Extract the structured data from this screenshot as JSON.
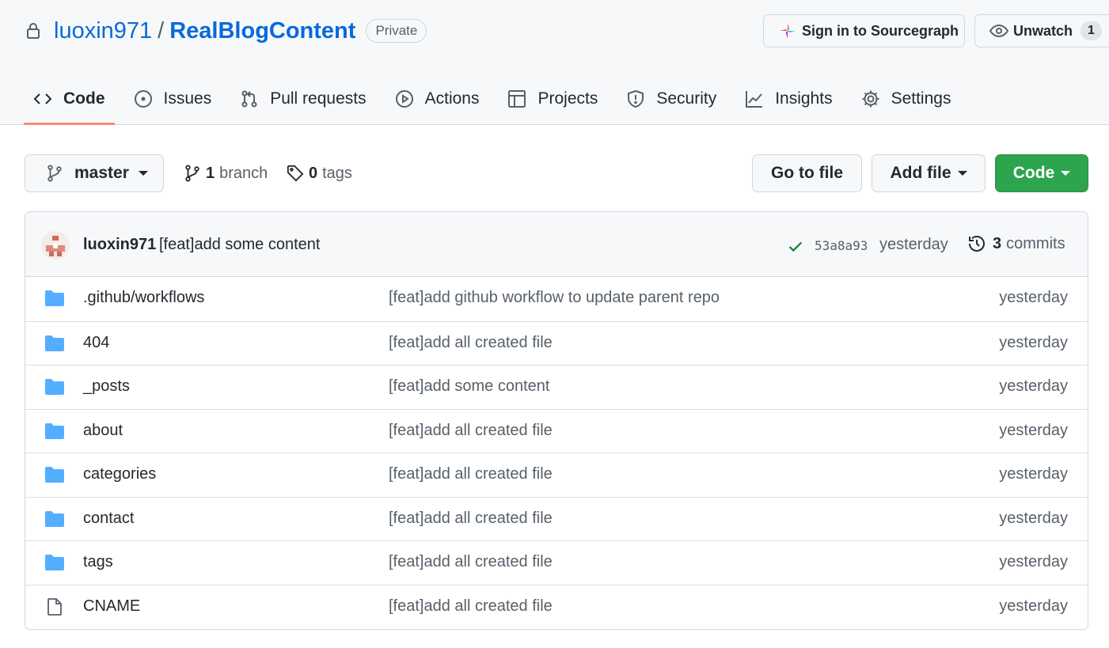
{
  "repo": {
    "owner": "luoxin971",
    "separator": "/",
    "name": "RealBlogContent",
    "visibility": "Private"
  },
  "header_actions": {
    "sourcegraph_label": "Sign in to Sourcegraph",
    "unwatch_label": "Unwatch",
    "watch_count": "1"
  },
  "tabs": [
    {
      "label": "Code",
      "icon": "code-icon",
      "active": true
    },
    {
      "label": "Issues",
      "icon": "issue-icon"
    },
    {
      "label": "Pull requests",
      "icon": "pull-request-icon"
    },
    {
      "label": "Actions",
      "icon": "play-icon"
    },
    {
      "label": "Projects",
      "icon": "table-icon"
    },
    {
      "label": "Security",
      "icon": "shield-icon"
    },
    {
      "label": "Insights",
      "icon": "graph-icon"
    },
    {
      "label": "Settings",
      "icon": "gear-icon"
    }
  ],
  "toolbar": {
    "branch": "master",
    "branch_count": "1",
    "branch_label": "branch",
    "tag_count": "0",
    "tag_label": "tags",
    "goto_label": "Go to file",
    "add_file_label": "Add file",
    "code_label": "Code"
  },
  "latest_commit": {
    "author": "luoxin971",
    "message": "[feat]add some content",
    "sha": "53a8a93",
    "time": "yesterday",
    "commit_count": "3",
    "commits_label": "commits"
  },
  "files": [
    {
      "type": "folder",
      "name": ".github/workflows",
      "message": "[feat]add github workflow to update parent repo",
      "time": "yesterday"
    },
    {
      "type": "folder",
      "name": "404",
      "message": "[feat]add all created file",
      "time": "yesterday"
    },
    {
      "type": "folder",
      "name": "_posts",
      "message": "[feat]add some content",
      "time": "yesterday"
    },
    {
      "type": "folder",
      "name": "about",
      "message": "[feat]add all created file",
      "time": "yesterday"
    },
    {
      "type": "folder",
      "name": "categories",
      "message": "[feat]add all created file",
      "time": "yesterday"
    },
    {
      "type": "folder",
      "name": "contact",
      "message": "[feat]add all created file",
      "time": "yesterday"
    },
    {
      "type": "folder",
      "name": "tags",
      "message": "[feat]add all created file",
      "time": "yesterday"
    },
    {
      "type": "file",
      "name": "CNAME",
      "message": "[feat]add all created file",
      "time": "yesterday"
    }
  ],
  "colors": {
    "link": "#0969da",
    "primary_button": "#2da44e",
    "folder": "#54aeff",
    "active_tab_underline": "#fd8c73",
    "check": "#1a7f37"
  }
}
